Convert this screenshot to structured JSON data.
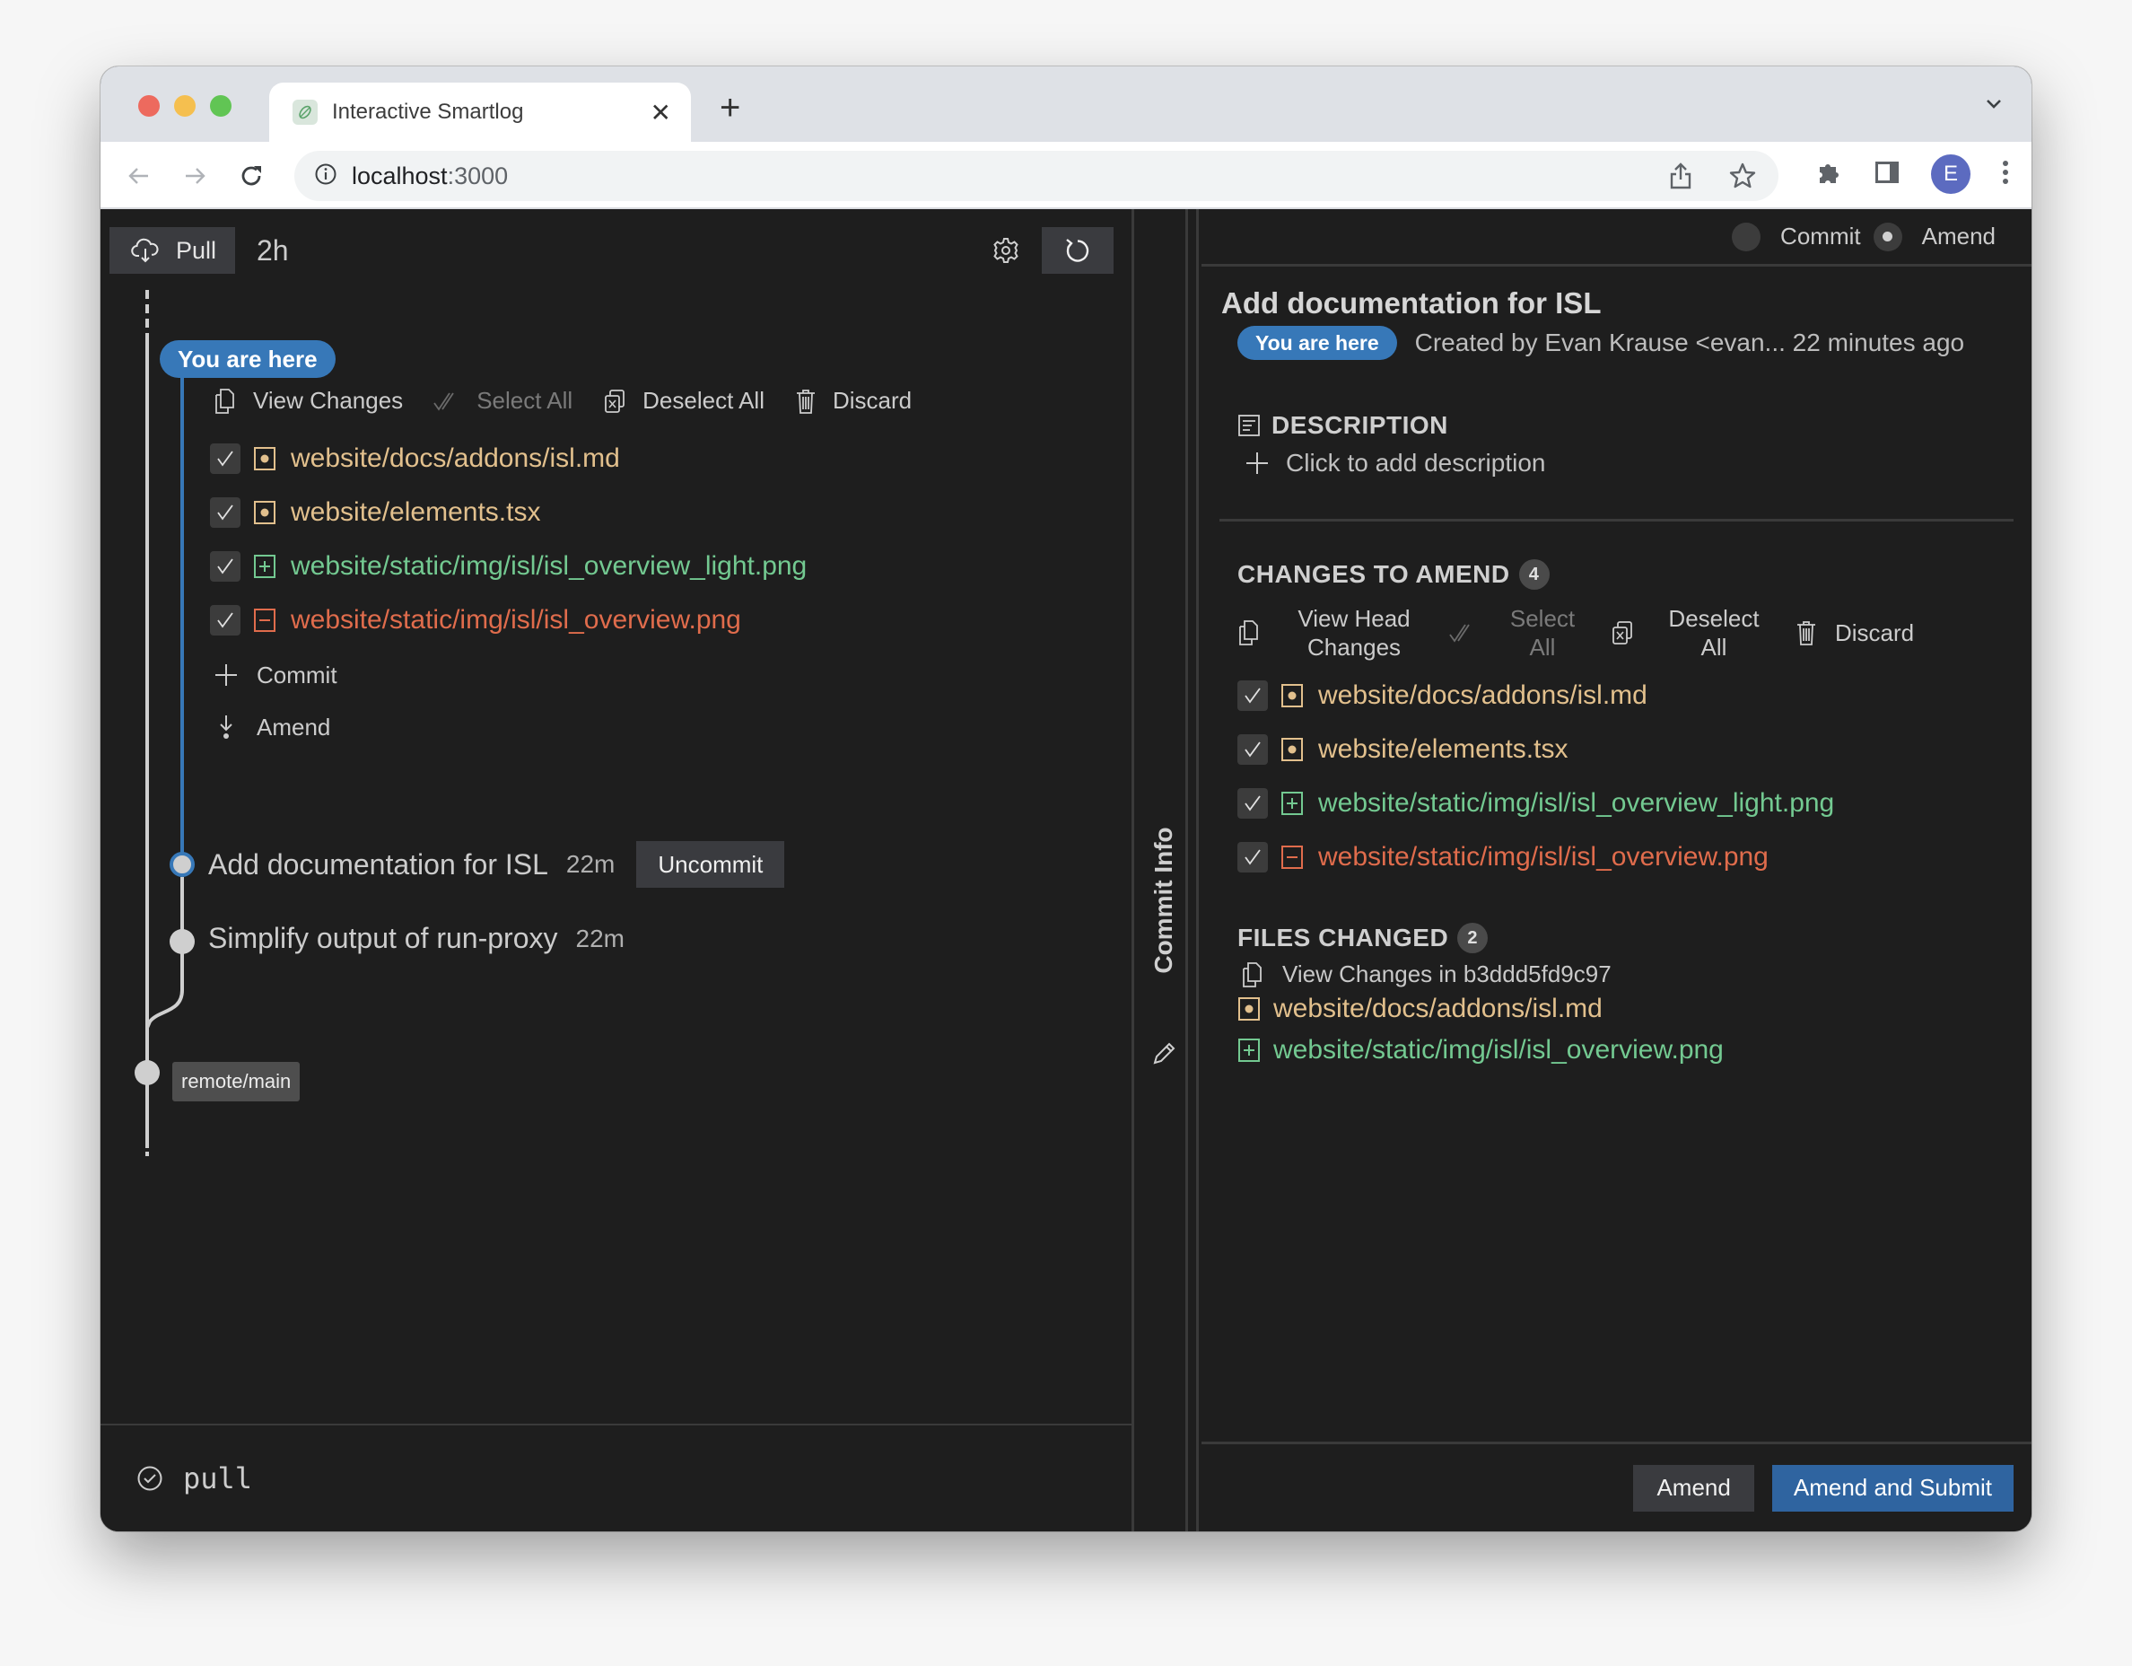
{
  "browser": {
    "tab_title": "Interactive Smartlog",
    "new_tab_label": "+",
    "url_host": "localhost",
    "url_port": ":3000",
    "profile_initial": "E"
  },
  "toolbar": {
    "pull_label": "Pull",
    "pull_age": "2h"
  },
  "smartlog": {
    "you_are_here": "You are here",
    "working_copy_actions": {
      "view_changes": "View Changes",
      "select_all": "Select All",
      "deselect_all": "Deselect All",
      "discard": "Discard"
    },
    "uncommitted_files": [
      {
        "path": "website/docs/addons/isl.md",
        "status": "modified",
        "checked": true
      },
      {
        "path": "website/elements.tsx",
        "status": "modified",
        "checked": true
      },
      {
        "path": "website/static/img/isl/isl_overview_light.png",
        "status": "added",
        "checked": true
      },
      {
        "path": "website/static/img/isl/isl_overview.png",
        "status": "removed",
        "checked": true
      }
    ],
    "commit_label": "Commit",
    "amend_label": "Amend",
    "commits": [
      {
        "title": "Add documentation for ISL",
        "age": "22m",
        "is_head": true,
        "action": "Uncommit"
      },
      {
        "title": "Simplify output of run-proxy",
        "age": "22m",
        "is_head": false
      }
    ],
    "remote_bookmark": "remote/main"
  },
  "command_status": {
    "command": "pull",
    "state": "success"
  },
  "drawer": {
    "label": "Commit Info"
  },
  "commit_info": {
    "mode_options": [
      {
        "label": "Commit",
        "selected": false
      },
      {
        "label": "Amend",
        "selected": true
      }
    ],
    "title": "Add documentation for ISL",
    "badge": "You are here",
    "created": "Created by Evan Krause <evan... 22 minutes ago",
    "description_heading": "DESCRIPTION",
    "add_description": "Click to add description",
    "changes_heading": "CHANGES TO AMEND",
    "changes_count": "4",
    "changes_actions": {
      "view_head_changes": "View Head Changes",
      "select_all": "Select All",
      "deselect_all": "Deselect All",
      "discard": "Discard"
    },
    "changes_files": [
      {
        "path": "website/docs/addons/isl.md",
        "status": "modified",
        "checked": true
      },
      {
        "path": "website/elements.tsx",
        "status": "modified",
        "checked": true
      },
      {
        "path": "website/static/img/isl/isl_overview_light.png",
        "status": "added",
        "checked": true
      },
      {
        "path": "website/static/img/isl/isl_overview.png",
        "status": "removed",
        "checked": true
      }
    ],
    "files_changed_heading": "FILES CHANGED",
    "files_changed_count": "2",
    "view_changes_in": "View Changes in b3ddd5fd9c97",
    "files_changed": [
      {
        "path": "website/docs/addons/isl.md",
        "status": "modified"
      },
      {
        "path": "website/static/img/isl/isl_overview.png",
        "status": "added"
      }
    ],
    "amend_button": "Amend",
    "amend_submit_button": "Amend and Submit"
  },
  "colors": {
    "accent": "#3778b8",
    "primary_button": "#2f64a0",
    "modified": "#e2c08d",
    "added": "#73c991",
    "removed": "#e06c4c",
    "background": "#1e1e1e"
  }
}
